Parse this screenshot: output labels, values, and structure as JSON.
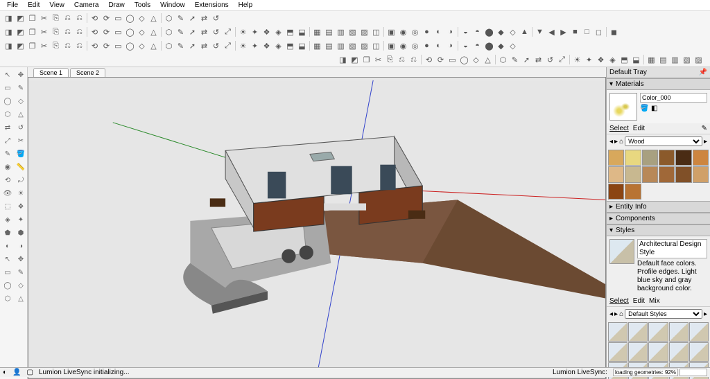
{
  "menu": [
    "File",
    "Edit",
    "View",
    "Camera",
    "Draw",
    "Tools",
    "Window",
    "Extensions",
    "Help"
  ],
  "scenes": [
    "Scene 1",
    "Scene 2"
  ],
  "active_scene": 1,
  "tray": {
    "title": "Default Tray",
    "materials": {
      "header": "Materials",
      "name_value": "Color_000",
      "tabs": [
        "Select",
        "Edit"
      ],
      "dropdown": "Wood",
      "swatches": [
        "#d8a85c",
        "#e8d880",
        "#a8a080",
        "#8b5a2b",
        "#4a2c14",
        "#cd853f",
        "#deb887",
        "#c8b890",
        "#b88858",
        "#a06838",
        "#805028",
        "#d0a068",
        "#8b4513",
        "#b87333"
      ]
    },
    "entity_info": "Entity Info",
    "components": "Components",
    "styles": {
      "header": "Styles",
      "name": "Architectural Design Style",
      "desc": "Default face colors. Profile edges. Light blue sky and gray background color.",
      "tabs": [
        "Select",
        "Edit",
        "Mix"
      ],
      "dropdown": "Default Styles"
    }
  },
  "status": {
    "left_icons": 3,
    "msg": "Lumion LiveSync initializing...",
    "right_label": "Lumion LiveSync:",
    "right_value": "loading geometries: 92%"
  }
}
